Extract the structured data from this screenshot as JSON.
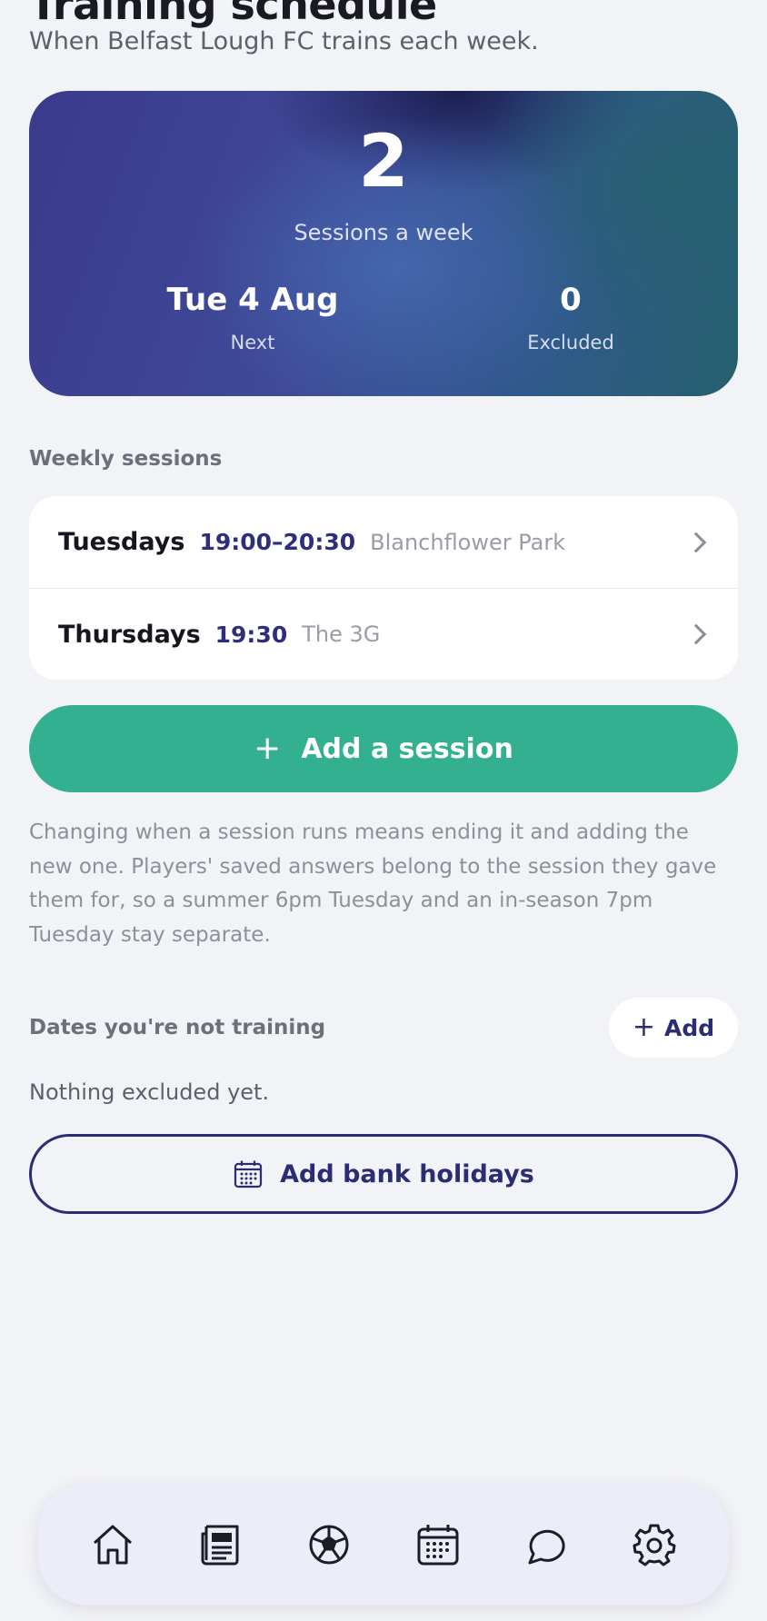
{
  "page": {
    "title": "Training schedule",
    "subtitle": "When Belfast Lough FC trains each week."
  },
  "summary": {
    "sessions_count": "2",
    "sessions_label": "Sessions a week",
    "next_value": "Tue 4 Aug",
    "next_label": "Next",
    "excluded_value": "0",
    "excluded_label": "Excluded"
  },
  "weekly": {
    "heading": "Weekly sessions",
    "sessions": [
      {
        "day": "Tuesdays",
        "time": "19:00–20:30",
        "place": "Blanchflower Park"
      },
      {
        "day": "Thursdays",
        "time": "19:30",
        "place": "The 3G"
      }
    ],
    "add_button": "Add a session",
    "note": "Changing when a session runs means ending it and adding the new one. Players' saved answers belong to the session they gave them for, so a summer 6pm Tuesday and an in-season 7pm Tuesday stay separate."
  },
  "exclusions": {
    "heading": "Dates you're not training",
    "add_label": "Add",
    "empty_text": "Nothing excluded yet.",
    "bank_holidays_button": "Add bank holidays"
  },
  "tabbar": {
    "icons": [
      "home-icon",
      "news-icon",
      "football-icon",
      "calendar-icon",
      "chat-icon",
      "settings-icon"
    ]
  },
  "colors": {
    "accent_green": "#32b08f",
    "brand_navy": "#2b2c74",
    "background": "#f2f3f7"
  }
}
